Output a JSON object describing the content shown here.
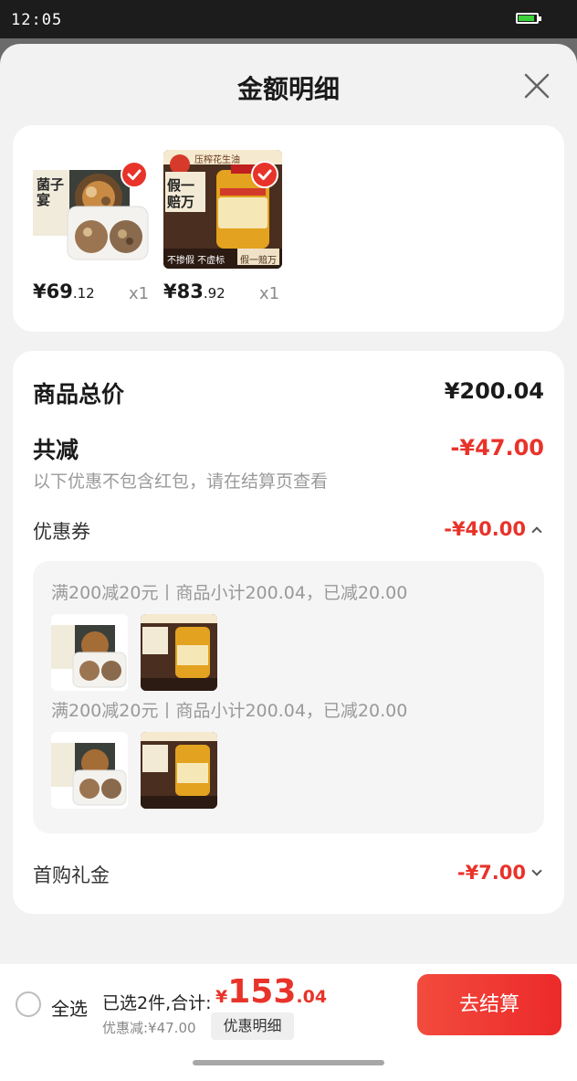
{
  "status_bar": {
    "time": "12:05",
    "battery_color": "#3ad13a"
  },
  "sheet": {
    "title": "金额明细"
  },
  "products": [
    {
      "price_int": "¥69",
      "price_dec": ".12",
      "qty": "x1",
      "image": "mushroom-gift-box",
      "box_text": "菌子宴"
    },
    {
      "price_int": "¥83",
      "price_dec": ".92",
      "qty": "x1",
      "image": "peanut-oil",
      "top_text": "压榨花生油",
      "box_text": "假一赔万",
      "bottom_left": "不掺假 不虚标",
      "bottom_right": "假一赔万"
    }
  ],
  "summary": {
    "total_label": "商品总价",
    "total_value": "¥200.04",
    "reduce_label": "共减",
    "reduce_value": "-¥47.00",
    "note": "以下优惠不包含红包，请在结算页查看",
    "coupon_label": "优惠券",
    "coupon_value": "-¥40.00",
    "coupons": [
      {
        "text": "满200减20元丨商品小计200.04，已减20.00"
      },
      {
        "text": "满200减20元丨商品小计200.04，已减20.00"
      }
    ],
    "gift_label": "首购礼金",
    "gift_value": "-¥7.00"
  },
  "bottom_bar": {
    "select_all": "全选",
    "selected_text": "已选2件,合计:",
    "total_currency": "¥",
    "total_int": "153",
    "total_dec": ".04",
    "discount_text": "优惠减:¥47.00",
    "detail_chip": "优惠明细",
    "checkout": "去结算"
  },
  "colors": {
    "accent": "#e8332a",
    "background": "#f2f2f2"
  }
}
